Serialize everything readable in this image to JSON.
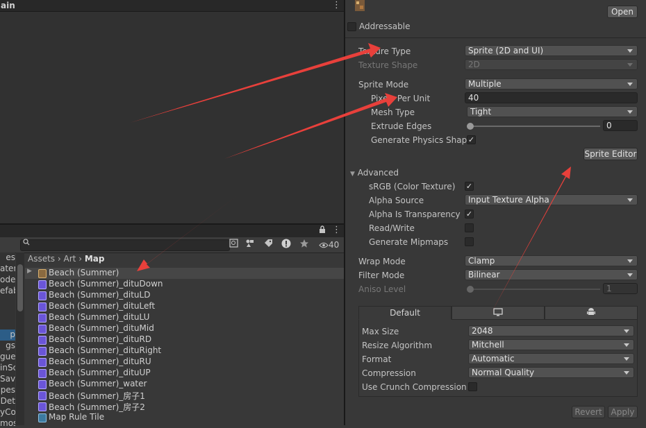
{
  "scene": {
    "title": "ain",
    "menu": "⋮"
  },
  "project": {
    "lock": "🔒",
    "menu": "⋮",
    "search_placeholder": "",
    "hidden_count": "40",
    "breadcrumb": [
      "Assets",
      "Art",
      "Map"
    ],
    "tree_items": [
      "es",
      "ateri",
      "odel",
      "efab",
      "p",
      "gs",
      "gueI",
      "inSc",
      "Save",
      "pes",
      "Det",
      "yCo",
      "mos"
    ],
    "assets": [
      "Beach (Summer)",
      "Beach (Summer)_dituDown",
      "Beach (Summer)_dituLD",
      "Beach (Summer)_dituLeft",
      "Beach (Summer)_dituLU",
      "Beach (Summer)_dituMid",
      "Beach (Summer)_dituRD",
      "Beach (Summer)_dituRight",
      "Beach (Summer)_dituRU",
      "Beach (Summer)_dituUP",
      "Beach (Summer)_water",
      "Beach (Summer)_房子1",
      "Beach (Summer)_房子2",
      "Map Rule Tile"
    ]
  },
  "inspector": {
    "open_label": "Open",
    "addressable_label": "Addressable",
    "texture_type": {
      "label": "Texture Type",
      "value": "Sprite (2D and UI)"
    },
    "texture_shape": {
      "label": "Texture Shape",
      "value": "2D"
    },
    "sprite_mode": {
      "label": "Sprite Mode",
      "value": "Multiple"
    },
    "pixels_per_unit": {
      "label": "Pixels Per Unit",
      "value": "40"
    },
    "mesh_type": {
      "label": "Mesh Type",
      "value": "Tight"
    },
    "extrude_edges": {
      "label": "Extrude Edges",
      "value": "0"
    },
    "generate_physics_shape": {
      "label": "Generate Physics Shape",
      "checked": "✓"
    },
    "sprite_editor_label": "Sprite Editor",
    "advanced_label": "Advanced",
    "srgb": {
      "label": "sRGB (Color Texture)",
      "checked": "✓"
    },
    "alpha_source": {
      "label": "Alpha Source",
      "value": "Input Texture Alpha"
    },
    "alpha_transparency": {
      "label": "Alpha Is Transparency",
      "checked": "✓"
    },
    "read_write": {
      "label": "Read/Write"
    },
    "generate_mipmaps": {
      "label": "Generate Mipmaps"
    },
    "wrap_mode": {
      "label": "Wrap Mode",
      "value": "Clamp"
    },
    "filter_mode": {
      "label": "Filter Mode",
      "value": "Bilinear"
    },
    "aniso_level": {
      "label": "Aniso Level",
      "value": "1"
    },
    "platform_tabs": {
      "default": "Default",
      "standalone_icon": "🖥",
      "android_icon": "🤖"
    },
    "max_size": {
      "label": "Max Size",
      "value": "2048"
    },
    "resize_algorithm": {
      "label": "Resize Algorithm",
      "value": "Mitchell"
    },
    "format": {
      "label": "Format",
      "value": "Automatic"
    },
    "compression": {
      "label": "Compression",
      "value": "Normal Quality"
    },
    "crunch": {
      "label": "Use Crunch Compression"
    },
    "revert_label": "Revert",
    "apply_label": "Apply"
  },
  "colors": {
    "arrow": "#e8403b",
    "selection": "#2c5d87"
  }
}
